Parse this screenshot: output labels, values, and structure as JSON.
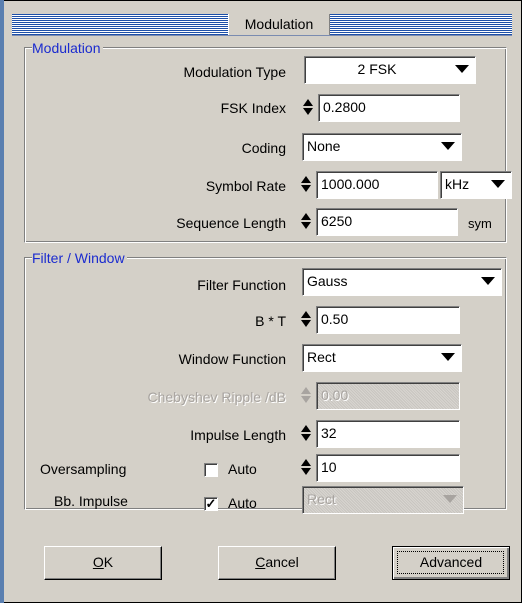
{
  "window": {
    "title": "Modulation"
  },
  "modulation_group": {
    "legend": "Modulation",
    "modulation_type": {
      "label": "Modulation Type",
      "value": "2 FSK"
    },
    "fsk_index": {
      "label": "FSK Index",
      "value": "0.2800"
    },
    "coding": {
      "label": "Coding",
      "value": "None"
    },
    "symbol_rate": {
      "label": "Symbol  Rate",
      "value": "1000.000",
      "unit": "kHz"
    },
    "sequence_length": {
      "label": "Sequence Length",
      "value": "6250",
      "unit": "sym"
    }
  },
  "filter_group": {
    "legend": "Filter / Window",
    "filter_function": {
      "label": "Filter Function",
      "value": "Gauss"
    },
    "bt": {
      "label": "B * T",
      "value": "0.50"
    },
    "window_function": {
      "label": "Window Function",
      "value": "Rect"
    },
    "chebyshev_ripple": {
      "label": "Chebyshev Ripple /dB",
      "value": "0.00"
    },
    "impulse_length": {
      "label": "Impulse Length",
      "value": "32"
    },
    "oversampling": {
      "label": "Oversampling",
      "auto_label": "Auto",
      "auto_checked": false,
      "value": "10"
    },
    "bb_impulse": {
      "label": "Bb. Impulse",
      "auto_label": "Auto",
      "auto_checked": true,
      "value": "Rect"
    }
  },
  "buttons": {
    "ok_mnemonic": "O",
    "ok_rest": "K",
    "cancel_mnemonic": "C",
    "cancel_rest": "ancel",
    "advanced": "Advanced"
  },
  "icons": {
    "dropdown": "dropdown-arrow-icon",
    "spinner": "spinner-arrows-icon",
    "checkmark": "✓"
  }
}
